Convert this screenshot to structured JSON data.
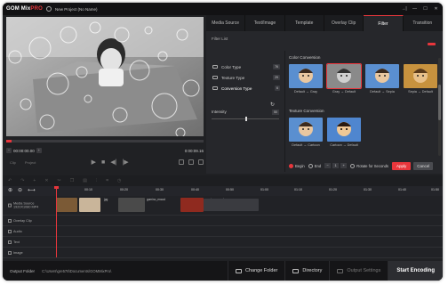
{
  "window": {
    "logo_main": "GOM Mix",
    "logo_accent": "PRO",
    "title": "New Project (No Name)",
    "controls": [
      "→|",
      "—",
      "☐",
      "✕"
    ]
  },
  "player": {
    "current_time": "00:00:00.00",
    "end_time": "0:00:09.16",
    "labels": [
      "Clip",
      "Project"
    ]
  },
  "panel": {
    "tabs": [
      "Media Source",
      "Text/Image",
      "Template",
      "Overlay Clip",
      "Filter",
      "Transition"
    ],
    "active_tab": "Filter",
    "filter_list_label": "Filter List",
    "categories": [
      {
        "label": "Color Type",
        "count": "76"
      },
      {
        "label": "Texture Type",
        "count": "29"
      },
      {
        "label": "Conversion Type",
        "count": "6"
      }
    ],
    "intensity_label": "Intensity",
    "intensity_value": "50",
    "color_conversion_title": "Color Conversion",
    "color_conversion": [
      {
        "caption": "Default → Gray"
      },
      {
        "caption": "Gray → Default"
      },
      {
        "caption": "Default → Sepia"
      },
      {
        "caption": "Sepia → Default"
      }
    ],
    "texture_conversion_title": "Texture Conversion",
    "texture_conversion": [
      {
        "caption": "Default → Cartoon"
      },
      {
        "caption": "Cartoon → Default"
      }
    ],
    "apply_row": {
      "begin": "Begin",
      "end": "End",
      "seconds_value": "1",
      "rotate_label": "Rotate for Seconds",
      "apply": "Apply",
      "cancel": "Cancel"
    }
  },
  "timeline": {
    "ruler_ticks": [
      "00:10",
      "00:20",
      "00:30",
      "00:40",
      "00:50",
      "01:00",
      "01:10",
      "01:20",
      "01:30",
      "01:40",
      "01:50"
    ],
    "tracks": [
      {
        "label": "Media Source",
        "sub": "1920X1080 MP4"
      },
      {
        "label": "Overlay Clip"
      },
      {
        "label": "Audio"
      },
      {
        "label": "Text"
      },
      {
        "label": "Image"
      }
    ],
    "clip_labels": [
      "jpg",
      "gomino_encod",
      "gomino_encod"
    ]
  },
  "bottom": {
    "output_folder_label": "Output Folder",
    "output_path": "C:\\Users\\gre578\\Documents\\GOMMixPro\\",
    "change_folder": "Change Folder",
    "directory": "Directory",
    "output_settings": "Output Settings",
    "start_encoding": "Start Encoding"
  }
}
